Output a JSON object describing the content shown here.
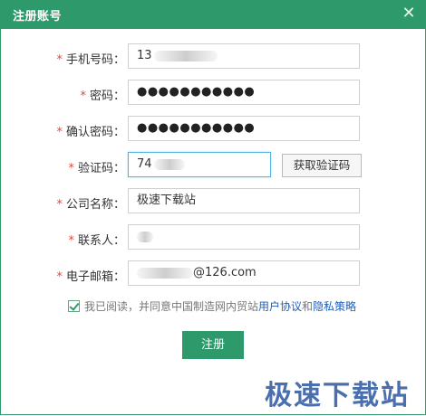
{
  "window": {
    "title": "注册账号",
    "close_icon": "close-icon"
  },
  "form": {
    "required_mark": "*",
    "phone": {
      "label": "手机号码：",
      "value": "13"
    },
    "password": {
      "label": "密码：",
      "value": "●●●●●●●●●●●"
    },
    "confirm_password": {
      "label": "确认密码：",
      "value": "●●●●●●●●●●●"
    },
    "captcha": {
      "label": "验证码：",
      "value": "74",
      "button": "获取验证码"
    },
    "company": {
      "label": "公司名称：",
      "value": "极速下载站"
    },
    "contact": {
      "label": "联系人：",
      "value": ""
    },
    "email": {
      "label": "电子邮箱：",
      "value": "@126.com"
    }
  },
  "agreement": {
    "checked": true,
    "text": "我已阅读，并同意中国制造网内贸站",
    "link_terms": "用户协议",
    "and": "和",
    "link_privacy": "隐私策略"
  },
  "register_button": "注册",
  "watermark": "极速下载站",
  "colors": {
    "accent": "#2e9a6b",
    "required": "#e2463b",
    "link": "#1d5fb8",
    "focus": "#54b3e1"
  }
}
